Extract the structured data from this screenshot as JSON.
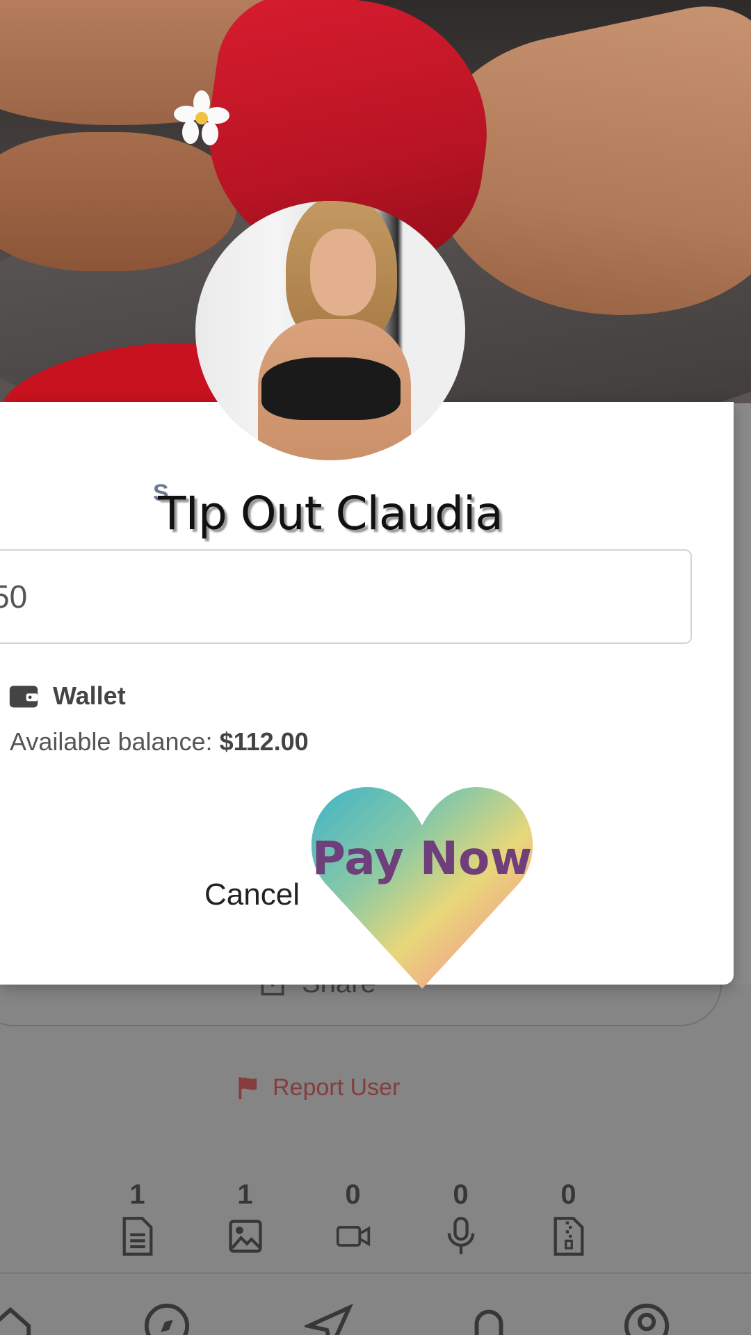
{
  "dialog": {
    "title": "TIp Out Claudia",
    "partial_label": "S",
    "amount_value": "50",
    "wallet_label": "Wallet",
    "balance_prefix": "Available balance: ",
    "balance_value": "$112.00",
    "cancel_label": "Cancel",
    "pay_label": "Pay Now"
  },
  "background": {
    "share_label": "Share",
    "report_label": "Report User",
    "stats": [
      {
        "count": "1",
        "icon": "document-icon"
      },
      {
        "count": "1",
        "icon": "image-icon"
      },
      {
        "count": "0",
        "icon": "video-icon"
      },
      {
        "count": "0",
        "icon": "microphone-icon"
      },
      {
        "count": "0",
        "icon": "archive-icon"
      }
    ],
    "nav_icons": [
      "home-icon",
      "compass-icon",
      "send-icon",
      "bell-icon",
      "profile-icon"
    ]
  },
  "colors": {
    "report": "#8a2a2a",
    "pay_text": "#6e3f7a"
  }
}
